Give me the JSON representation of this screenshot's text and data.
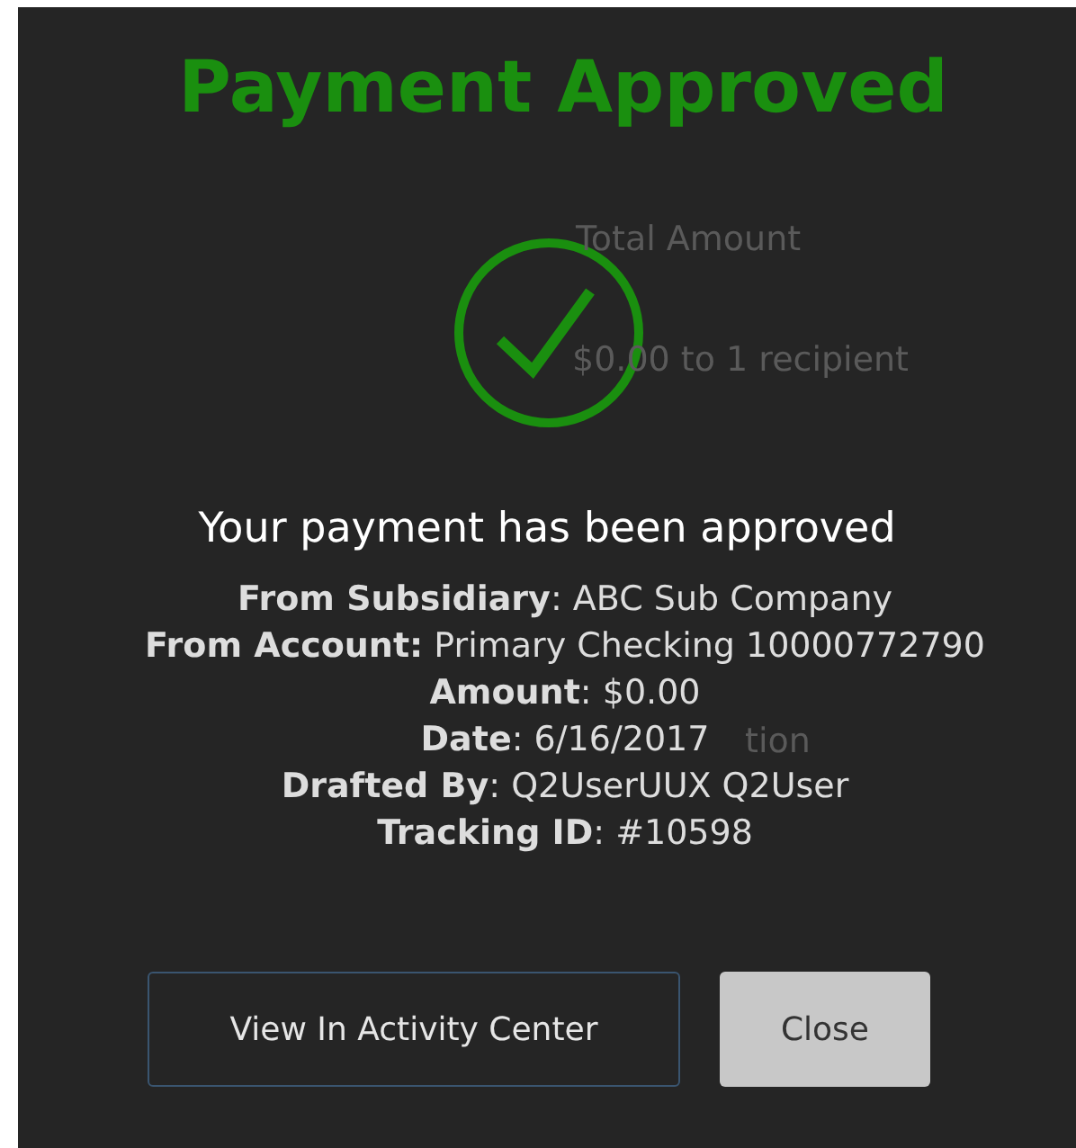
{
  "background_texts": [
    {
      "text": "Total Amount",
      "kind": "label"
    },
    {
      "text": "$0.00 to 1 recipient",
      "kind": "summary"
    },
    {
      "text": "tion",
      "kind": "fragment"
    }
  ],
  "dialog": {
    "title": "Payment Approved",
    "kind": "success",
    "message": "Your payment has been approved",
    "details": [
      {
        "text": "**From Subsidiary**: ABC Sub Company"
      },
      {
        "text": "**From Account:** Primary Checking 10000772790"
      },
      {
        "text": "**Amount**: $0.00"
      },
      {
        "text": "**Date**: 6/16/2017"
      },
      {
        "text": "**Drafted By**: Q2UserUUX Q2User"
      },
      {
        "text": "**Tracking ID**: #10598"
      }
    ],
    "buttons": [
      {
        "label": "View In Activity Center",
        "kind": "outline"
      },
      {
        "label": "Close",
        "kind": "filled"
      }
    ]
  }
}
